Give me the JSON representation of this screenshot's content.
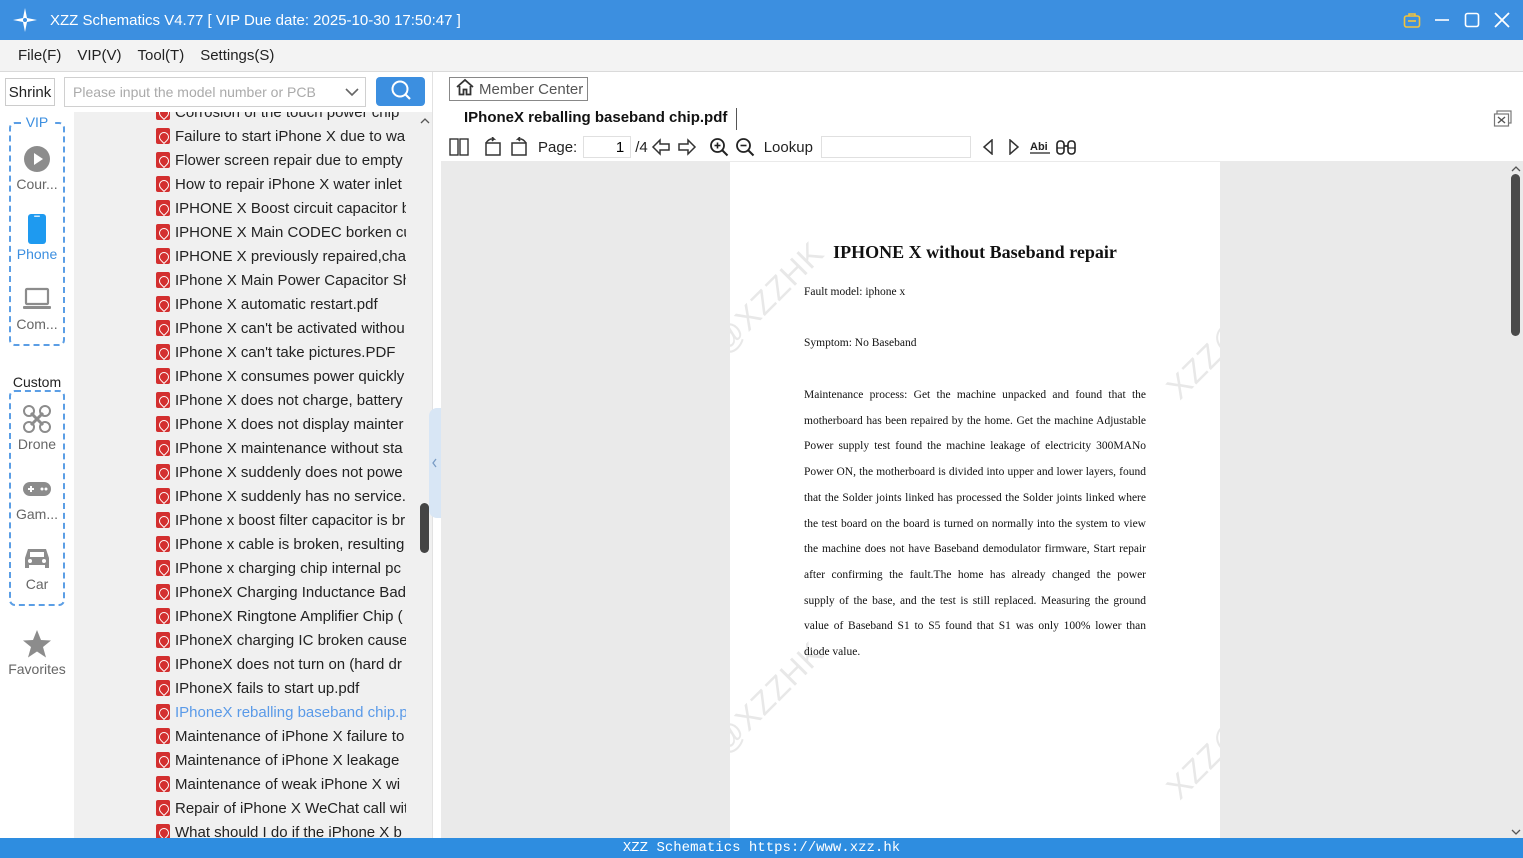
{
  "window": {
    "title": "XZZ Schematics V4.77 [ VIP Due date: 2025-10-30 17:50:47 ]"
  },
  "menu": [
    "File(F)",
    "VIP(V)",
    "Tool(T)",
    "Settings(S)"
  ],
  "rail": {
    "shrink_label": "Shrink",
    "vip_group_label": "VIP",
    "custom_group_label": "Custom",
    "items": [
      {
        "label": "Cour...",
        "icon": "play-icon"
      },
      {
        "label": "Phone",
        "icon": "phone-icon"
      },
      {
        "label": "Com...",
        "icon": "laptop-icon"
      },
      {
        "label": "Drone",
        "icon": "drone-icon"
      },
      {
        "label": "Gam...",
        "icon": "gamepad-icon"
      },
      {
        "label": "Car",
        "icon": "car-icon"
      },
      {
        "label": "Favorites",
        "icon": "star-icon"
      }
    ]
  },
  "search": {
    "placeholder": "Please input the model number or PCB"
  },
  "files": [
    "Corrosion of the touch power chip",
    "Failure to start iPhone X due to wa",
    "Flower screen repair due to empty",
    "How to repair iPhone X water inlet",
    "IPHONE X Boost circuit capacitor b",
    "IPHONE X Main CODEC borken cu",
    "IPHONE X previously repaired,char",
    "IPhone X Main Power Capacitor Sh",
    "IPhone X automatic restart.pdf",
    "IPhone X can't be activated withou",
    "IPhone X can't take pictures.PDF",
    "IPhone X consumes power quickly",
    "IPhone X does not charge, battery",
    "IPhone X does not display mainter",
    "IPhone X maintenance without sta",
    "IPhone X suddenly does not powe",
    "IPhone X suddenly has no service.p",
    "IPhone x boost filter capacitor is br",
    "IPhone x cable is broken, resulting",
    "IPhone x charging chip internal pc",
    "IPhoneX Charging Inductance Bad",
    "IPhoneX Ringtone Amplifier Chip (",
    "IPhoneX charging IC broken cause",
    "IPhoneX does not turn on (hard dr",
    "IPhoneX fails to start up.pdf",
    "IPhoneX reballing baseband chip.p",
    "Maintenance of iPhone X failure to",
    "Maintenance of iPhone X leakage",
    "Maintenance of weak iPhone X wi",
    "Repair of iPhone X WeChat call wit",
    "What should I do if the iPhone X b"
  ],
  "selected_file_index": 25,
  "viewer": {
    "member_center": "Member Center",
    "tab_title": "IPhoneX reballing baseband chip.pdf",
    "page_label": "Page:",
    "page_current": "1",
    "page_total": "/4",
    "lookup_label": "Lookup"
  },
  "document": {
    "title": "IPHONE X without Baseband repair",
    "fault_model": "Fault model: iphone x",
    "symptom": "Symptom: No Baseband",
    "body": "Maintenance process: Get the machine unpacked and found that the motherboard has been repaired by the home. Get the machine Adjustable Power supply test found the machine leakage of electricity 300MANo Power ON, the motherboard is divided into upper and lower layers, found that the Solder joints linked has processed the Solder joints linked where the test board on the board is turned on normally into the system to view the machine does not have Baseband demodulator firmware, Start repair after confirming the fault.The home has already changed the power supply of the base, and the test is still replaced. Measuring the ground value of Baseband S1 to S5 found that S1 was only 100% lower than diode value.",
    "watermark": "XZZ@XZZHK"
  },
  "status_bar": "XZZ Schematics https://www.xzz.hk",
  "colors": {
    "accent": "#3c8fe0",
    "selected_file": "#5a9ae8",
    "pdf_icon": "#d32f2f",
    "status_bar": "#2e8de0"
  }
}
